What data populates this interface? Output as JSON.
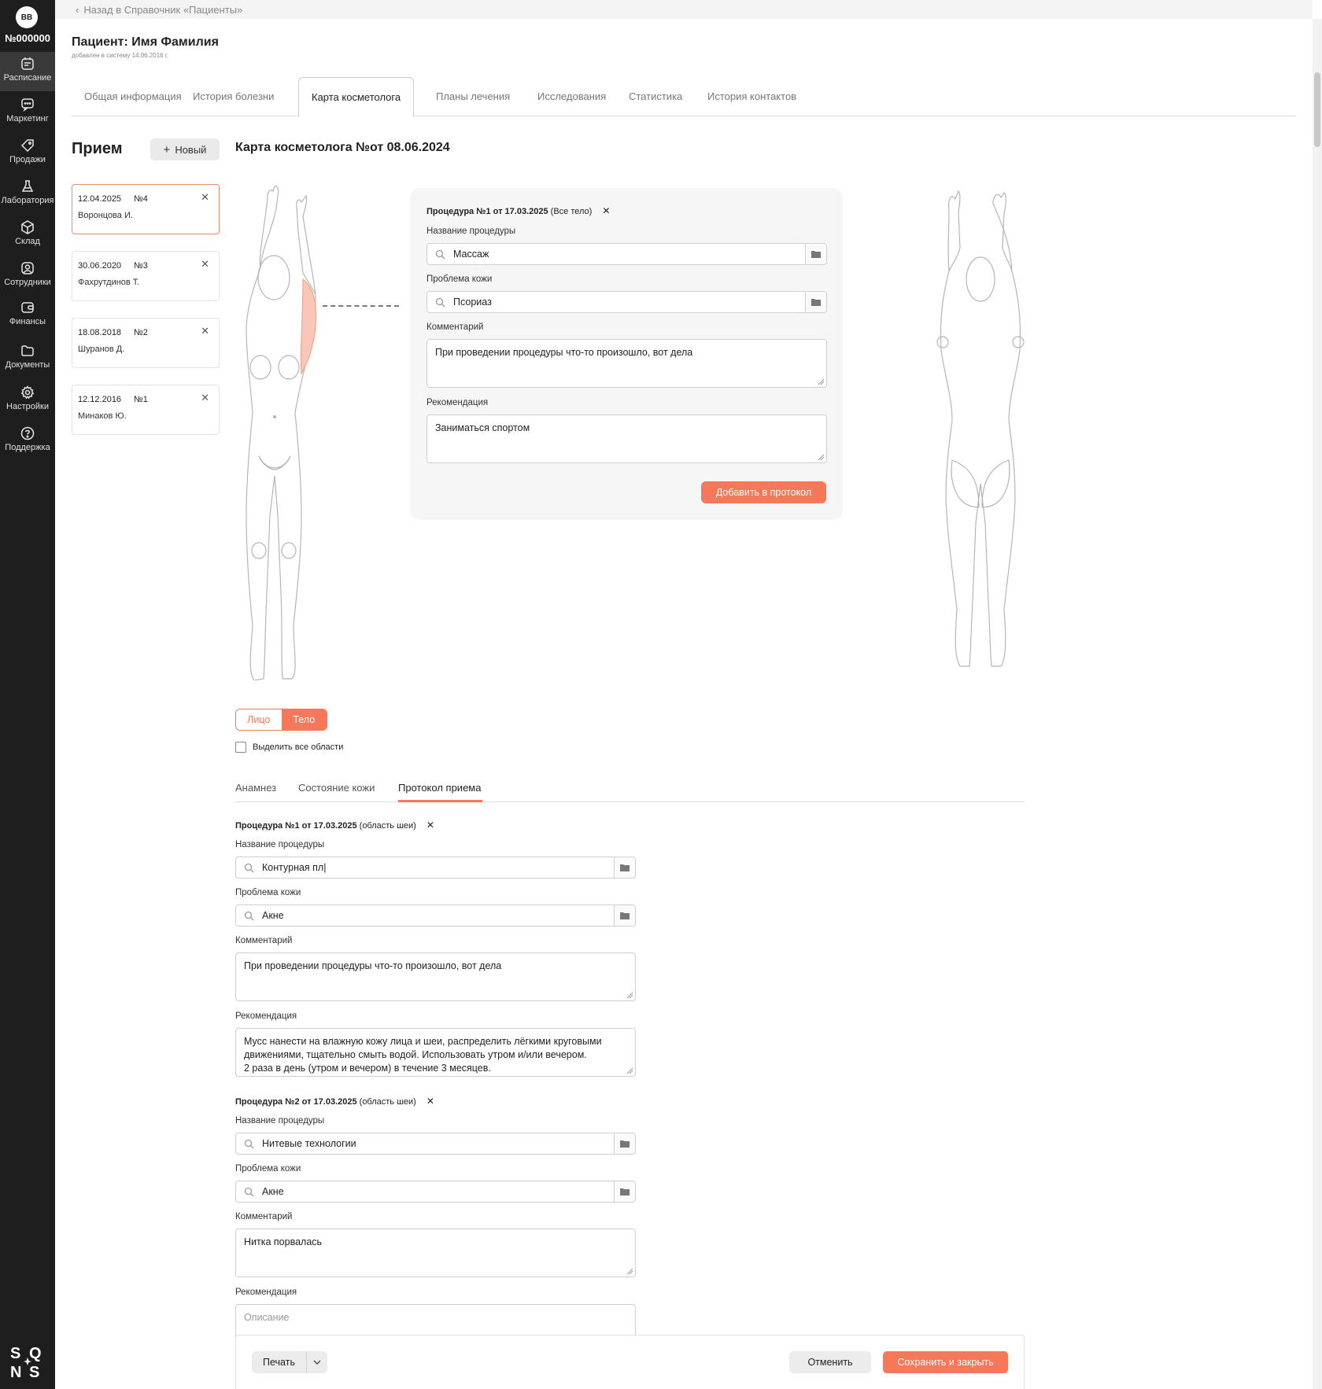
{
  "sidebar": {
    "avatar": "BB",
    "clinic_number": "№000000",
    "items": [
      {
        "label": "Расписание"
      },
      {
        "label": "Маркетинг"
      },
      {
        "label": "Продажи"
      },
      {
        "label": "Лаборатория"
      },
      {
        "label": "Склад"
      },
      {
        "label": "Сотрудники"
      },
      {
        "label": "Финансы"
      },
      {
        "label": "Документы"
      },
      {
        "label": "Настройки"
      },
      {
        "label": "Поддержка"
      }
    ],
    "logo_letters": [
      "S",
      "Q",
      "N",
      "S"
    ]
  },
  "topbar": {
    "back_link": "Назад в Справочник «Пациенты»"
  },
  "patient": {
    "title": "Пациент: Имя Фамилия",
    "added": "добавлен в систему 14.06.2016 г."
  },
  "tabs": [
    {
      "label": "Общая информация"
    },
    {
      "label": "История болезни"
    },
    {
      "label": "Карта косметолога"
    },
    {
      "label": "Планы лечения"
    },
    {
      "label": "Исследования"
    },
    {
      "label": "Статистика"
    },
    {
      "label": "История контактов"
    }
  ],
  "reception": {
    "title": "Прием",
    "new_button": "Новый",
    "visits": [
      {
        "date": "12.04.2025",
        "number": "№4",
        "name": "Воронцова И."
      },
      {
        "date": "30.06.2020",
        "number": "№3",
        "name": "Фахрутдинов Т."
      },
      {
        "date": "18.08.2018",
        "number": "№2",
        "name": "Шуранов Д."
      },
      {
        "date": "12.12.2016",
        "number": "№1",
        "name": "Минаков Ю."
      }
    ]
  },
  "card": {
    "title": "Карта косметолога №от 08.06.2024"
  },
  "popup": {
    "head_bold": "Процедура №1 от 17.03.2025",
    "head_rest": " (Все тело)",
    "proc_label": "Название процедуры",
    "proc_value": "Массаж",
    "problem_label": "Проблема кожи",
    "problem_value": "Псориаз",
    "comment_label": "Комментарий",
    "comment_value": "При проведении процедуры что-то произошло, вот дела",
    "rec_label": "Рекомендация",
    "rec_value": "Заниматься спортом",
    "add_button": "Добавить в протокол"
  },
  "view_toggle": {
    "face": "Лицо",
    "body": "Тело"
  },
  "select_all": "Выделить все области",
  "subtabs": [
    {
      "label": "Анамнез"
    },
    {
      "label": "Состояние кожи"
    },
    {
      "label": "Протокол приема"
    }
  ],
  "procedures": [
    {
      "head_bold": "Процедура №1 от 17.03.2025",
      "head_rest": " (область шеи)",
      "proc_label": "Название процедуры",
      "proc_value": "Контурная пл|",
      "problem_label": "Проблема кожи",
      "problem_value": "Акне",
      "comment_label": "Комментарий",
      "comment_value": "При проведении процедуры что-то произошло, вот дела",
      "rec_label": "Рекомендация",
      "rec_line1": "Мусс нанести на влажную кожу лица и шеи, распределить лёгкими круговыми",
      "rec_line2": "движениями, тщательно смыть водой. Использовать утром и/или вечером.",
      "rec_line3": "2 раза в день (утром и вечером) в течение 3 месяцев."
    },
    {
      "head_bold": "Процедура №2 от 17.03.2025",
      "head_rest": " (область шеи)",
      "proc_label": "Название процедуры",
      "proc_value": "Нитевые технологии",
      "problem_label": "Проблема кожи",
      "problem_value": "Акне",
      "comment_label": "Комментарий",
      "comment_value": "Нитка порвалась",
      "rec_label": "Рекомендация",
      "rec_placeholder": "Описание"
    }
  ],
  "footer": {
    "print": "Печать",
    "cancel": "Отменить",
    "save": "Сохранить и закрыть"
  },
  "colors": {
    "accent": "#f5785a",
    "sidebar_bg": "#1e1e1e",
    "highlight_zone": "#f8c7b8"
  }
}
